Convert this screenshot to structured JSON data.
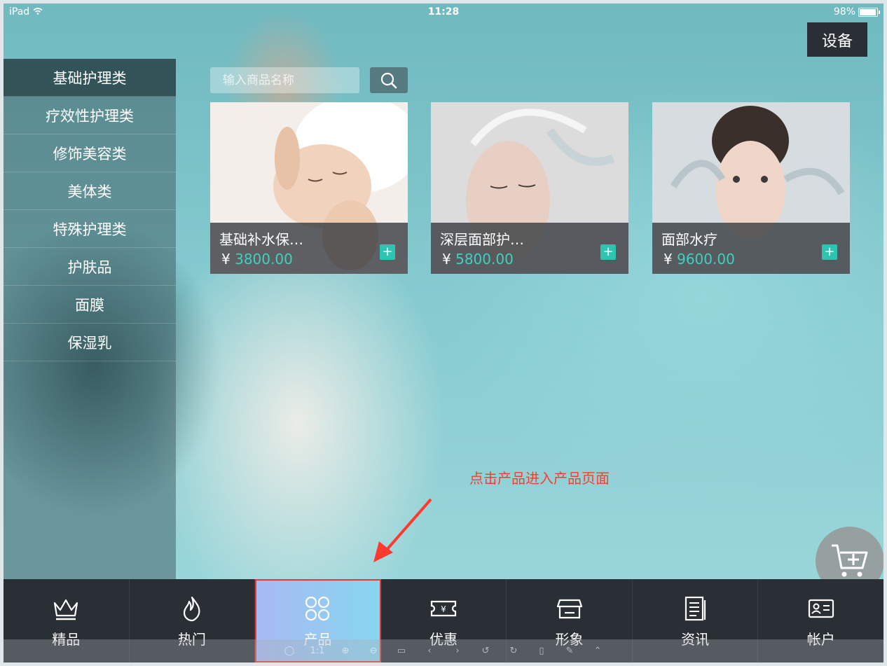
{
  "status_bar": {
    "carrier": "iPad",
    "time": "11:28",
    "battery": "98%"
  },
  "device_button": {
    "label": "设备"
  },
  "sidebar": {
    "items": [
      {
        "label": "基础护理类"
      },
      {
        "label": "疗效性护理类"
      },
      {
        "label": "修饰美容类"
      },
      {
        "label": "美体类"
      },
      {
        "label": "特殊护理类"
      },
      {
        "label": "护肤品"
      },
      {
        "label": "面膜"
      },
      {
        "label": "保湿乳"
      }
    ]
  },
  "search": {
    "placeholder": "输入商品名称",
    "icon": "search-icon"
  },
  "products": [
    {
      "name": "基础补水保…",
      "currency": "¥",
      "price": "3800.00"
    },
    {
      "name": "深层面部护…",
      "currency": "¥",
      "price": "5800.00"
    },
    {
      "name": "面部水疗",
      "currency": "¥",
      "price": "9600.00"
    }
  ],
  "annotation": {
    "text": "点击产品进入产品页面",
    "color": "#ff3b2f"
  },
  "tabbar": {
    "tabs": [
      {
        "label": "精品",
        "icon": "crown-icon"
      },
      {
        "label": "热门",
        "icon": "flame-icon"
      },
      {
        "label": "产品",
        "icon": "clover-icon",
        "active": true
      },
      {
        "label": "优惠",
        "icon": "ticket-icon"
      },
      {
        "label": "形象",
        "icon": "store-icon"
      },
      {
        "label": "资讯",
        "icon": "news-icon"
      },
      {
        "label": "帐户",
        "icon": "id-card-icon"
      }
    ]
  },
  "toolstrip": {
    "zoom_label": "1:1"
  },
  "colors": {
    "accent": "#2fc4b2",
    "price": "#3fd0c0",
    "tabbar_bg": "#2a2f36"
  }
}
